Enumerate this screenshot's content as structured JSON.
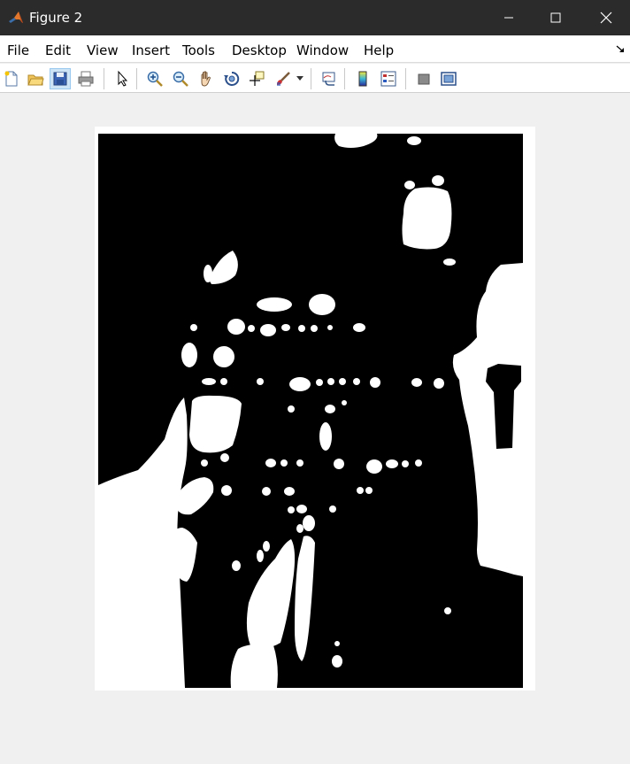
{
  "window": {
    "title": "Figure 2",
    "controls": [
      "minimize",
      "maximize",
      "close"
    ]
  },
  "menu": {
    "items": [
      "File",
      "Edit",
      "View",
      "Insert",
      "Tools",
      "Desktop",
      "Window",
      "Help"
    ]
  },
  "toolbar": {
    "tools": [
      "new-figure-icon",
      "open-file-icon",
      "save-icon",
      "print-icon",
      "pointer-icon",
      "zoom-in-icon",
      "zoom-out-icon",
      "pan-icon",
      "rotate-3d-icon",
      "data-cursor-icon",
      "brush-icon",
      "brush-dropdown-icon",
      "link-plot-icon",
      "colorbar-icon",
      "legend-icon",
      "hide-plot-tools-icon",
      "show-plot-tools-icon"
    ],
    "active_tool": "save-icon"
  },
  "colors": {
    "titlebar": "#2b2b2b",
    "background": "#f0f0f0",
    "image_foreground": "#ffffff",
    "image_background": "#000000"
  },
  "figure": {
    "content": "binary image (black background with white regions)"
  }
}
